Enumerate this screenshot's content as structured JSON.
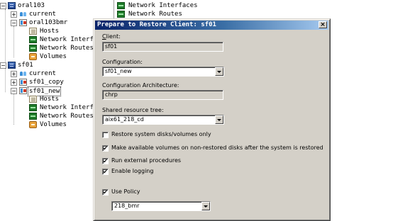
{
  "tree": {
    "oral103": "oral103",
    "oral103_current": "current",
    "oral103bmr": "oral103bmr",
    "oral103bmr_hosts": "Hosts",
    "oral103bmr_netif": "Network Interface",
    "oral103bmr_routes": "Network Routes",
    "oral103bmr_volumes": "Volumes",
    "sf01": "sf01",
    "sf01_current": "current",
    "sf01_copy": "sf01_copy",
    "sf01_new": "sf01_new",
    "sf01_new_hosts": "Hosts",
    "sf01_new_netif": "Network Interface",
    "sf01_new_routes": "Network Routes",
    "sf01_new_volumes": "Volumes"
  },
  "background_list": {
    "item1": "Network Interfaces",
    "item2": "Network Routes"
  },
  "dialog": {
    "title": "Prepare to Restore Client: sf01",
    "close_glyph": "×",
    "client_label": "Client:",
    "client_value": "sf01",
    "configuration_label": "Configuration:",
    "configuration_value": "sf01_new",
    "arch_label": "Configuration Architecture:",
    "arch_value": "chrp",
    "srt_label": "Shared resource tree:",
    "srt_value": "aix61_218_cd",
    "restore_system_label": "Restore system disks/volumes only",
    "restore_system_checked": false,
    "make_available_label": "Make available volumes on non-restored disks after the system is restored",
    "make_available_checked": true,
    "run_external_label": "Run external procedures",
    "run_external_checked": true,
    "enable_logging_label": "Enable logging",
    "enable_logging_checked": true,
    "use_policy_label": "Use Policy",
    "use_policy_checked": true,
    "policy_value": "218_bmr"
  },
  "check_glyph": "✔"
}
